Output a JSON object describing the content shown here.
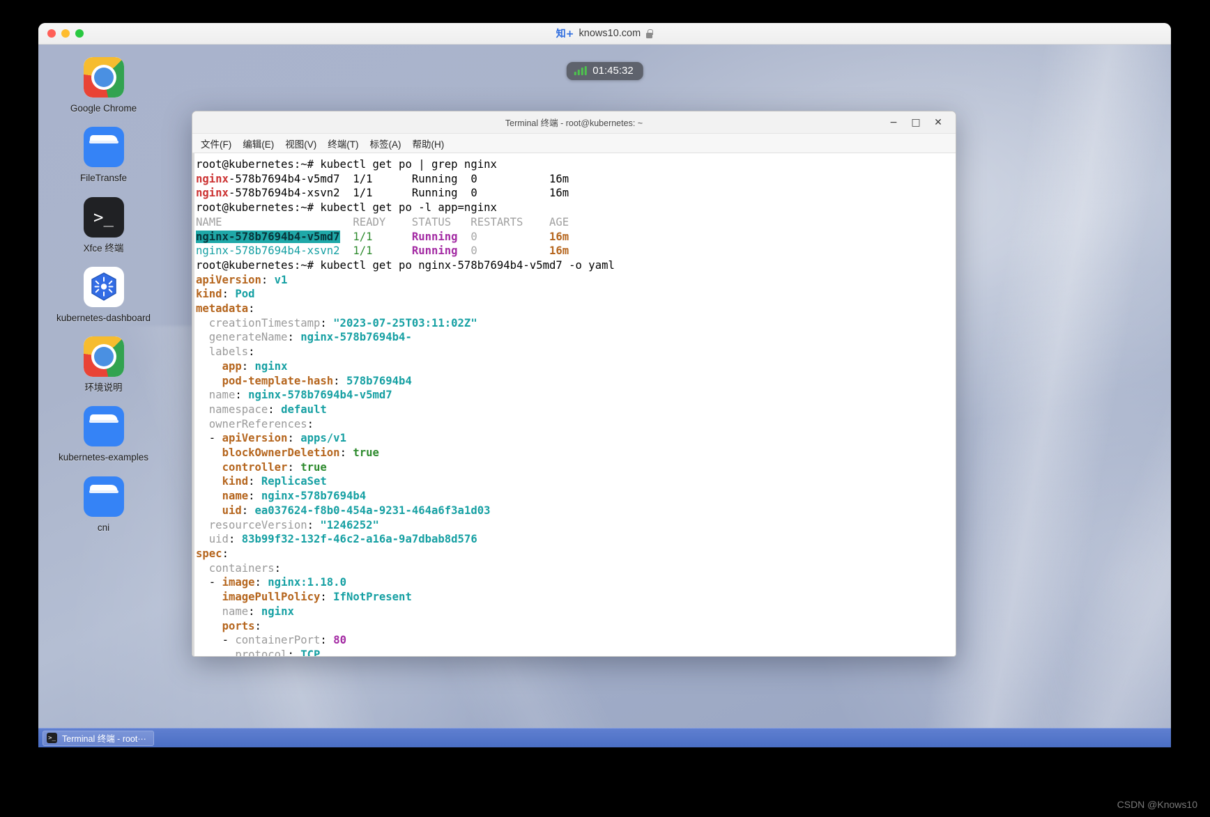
{
  "browser": {
    "traffic_lights": [
      "close",
      "minimize",
      "maximize"
    ],
    "badge_text": "知+",
    "url": "knows10.com",
    "lock_icon": "lock-icon"
  },
  "timer": {
    "signal_icon": "signal-bars-icon",
    "value": "01:45:32"
  },
  "desktop": {
    "icons": [
      {
        "name": "Google Chrome",
        "icon": "chrome-icon",
        "label": "Google Chrome"
      },
      {
        "name": "FileTransfer",
        "icon": "folder-icon",
        "label": "FileTransfe"
      },
      {
        "name": "Xfce Terminal",
        "icon": "terminal-icon",
        "label": "Xfce 终端"
      },
      {
        "name": "kubernetes-dashboard",
        "icon": "kubernetes-icon",
        "label": "kubernetes-dashboard"
      },
      {
        "name": "Environment",
        "icon": "chrome-icon",
        "label": "环境说明"
      },
      {
        "name": "kubernetes-examples",
        "icon": "folder-icon",
        "label": "kubernetes-examples"
      },
      {
        "name": "cni",
        "icon": "folder-icon",
        "label": "cni"
      }
    ]
  },
  "terminal": {
    "title": "Terminal 终端 - root@kubernetes: ~",
    "window_buttons": {
      "minimize": "−",
      "maximize": "□",
      "close": "✕"
    },
    "menu": [
      "文件(F)",
      "编辑(E)",
      "视图(V)",
      "终端(T)",
      "标签(A)",
      "帮助(H)"
    ],
    "prompt": "root@kubernetes:~# ",
    "commands": [
      "kubectl get po | grep nginx",
      "kubectl get po -l app=nginx",
      "kubectl get po nginx-578b7694b4-v5md7 -o yaml"
    ],
    "grep_output": [
      {
        "name_highlight": "nginx",
        "name_rest": "-578b7694b4-v5md7",
        "ready": "1/1",
        "status": "Running",
        "restarts": "0",
        "age": "16m"
      },
      {
        "name_highlight": "nginx",
        "name_rest": "-578b7694b4-xsvn2",
        "ready": "1/1",
        "status": "Running",
        "restarts": "0",
        "age": "16m"
      }
    ],
    "table_headers": [
      "NAME",
      "READY",
      "STATUS",
      "RESTARTS",
      "AGE"
    ],
    "table_rows": [
      {
        "name": "nginx-578b7694b4-v5md7",
        "selected": true,
        "ready": "1/1",
        "status": "Running",
        "restarts": "0",
        "age": "16m"
      },
      {
        "name": "nginx-578b7694b4-xsvn2",
        "selected": false,
        "ready": "1/1",
        "status": "Running",
        "restarts": "0",
        "age": "16m"
      }
    ],
    "yaml": {
      "apiVersion": "v1",
      "kind": "Pod",
      "metadata": {
        "creationTimestamp": "\"2023-07-25T03:11:02Z\"",
        "generateName": "nginx-578b7694b4-",
        "labels": {
          "app": "nginx",
          "pod-template-hash": "578b7694b4"
        },
        "name": "nginx-578b7694b4-v5md7",
        "namespace": "default",
        "ownerReferences": [
          {
            "apiVersion": "apps/v1",
            "blockOwnerDeletion": "true",
            "controller": "true",
            "kind": "ReplicaSet",
            "name": "nginx-578b7694b4",
            "uid": "ea037624-f8b0-454a-9231-464a6f3a1d03"
          }
        ],
        "resourceVersion": "\"1246252\"",
        "uid": "83b99f32-132f-46c2-a16a-9a7dbab8d576"
      },
      "spec": {
        "containers": [
          {
            "image": "nginx:1.18.0",
            "imagePullPolicy": "IfNotPresent",
            "name": "nginx",
            "ports": [
              {
                "containerPort": "80",
                "protocol": "TCP"
              }
            ]
          }
        ]
      }
    }
  },
  "taskbar": {
    "item_icon": "terminal-icon",
    "item_label": "Terminal 终端 - root···"
  },
  "watermark": "CSDN @Knows10",
  "colors": {
    "accent_blue": "#3583f6",
    "terminal_selection": "#1fa8a8",
    "taskbar": "#4a6ec4",
    "timer_badge": "#5e626c"
  }
}
